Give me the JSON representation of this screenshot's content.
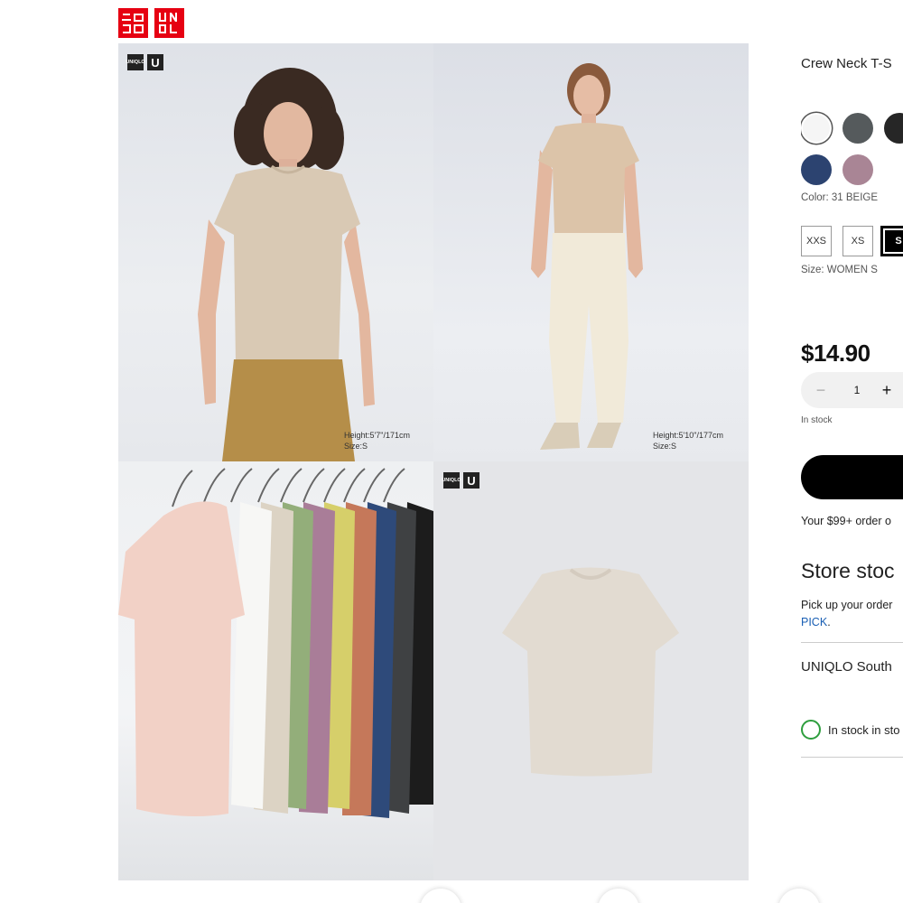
{
  "brand": {
    "logo_left": "ユニクロ",
    "logo_right": "UNIQLO"
  },
  "gallery": {
    "badge_uq": "UNIQLO",
    "badge_u": "U",
    "image1_caption": [
      "Height:5'7\"/171cm",
      "Size:S"
    ],
    "image2_caption": [
      "Height:5'10\"/177cm",
      "Size:S"
    ]
  },
  "product": {
    "title": "Crew Neck T-S",
    "colors": [
      {
        "name": "white",
        "hex": "#f5f5f5"
      },
      {
        "name": "dark-gray",
        "hex": "#555a5c"
      },
      {
        "name": "black",
        "hex": "#262626"
      },
      {
        "name": "navy",
        "hex": "#2c4370"
      },
      {
        "name": "purple",
        "hex": "#a98595"
      }
    ],
    "color_label": "Color: 31 BEIGE",
    "sizes": [
      "XXS",
      "XS",
      "S"
    ],
    "size_label": "Size: WOMEN S",
    "price": "$14.90",
    "quantity": "1",
    "minus": "−",
    "plus": "+",
    "stock_status": "In stock",
    "shipping_note": "Your $99+ order o",
    "store_stock_heading": "Store stoc",
    "pickup_line1": "Pick up your order",
    "pickup_link": "PICK",
    "pickup_period": ".",
    "store_name": "UNIQLO South",
    "store_stock_status": "In stock in sto"
  }
}
